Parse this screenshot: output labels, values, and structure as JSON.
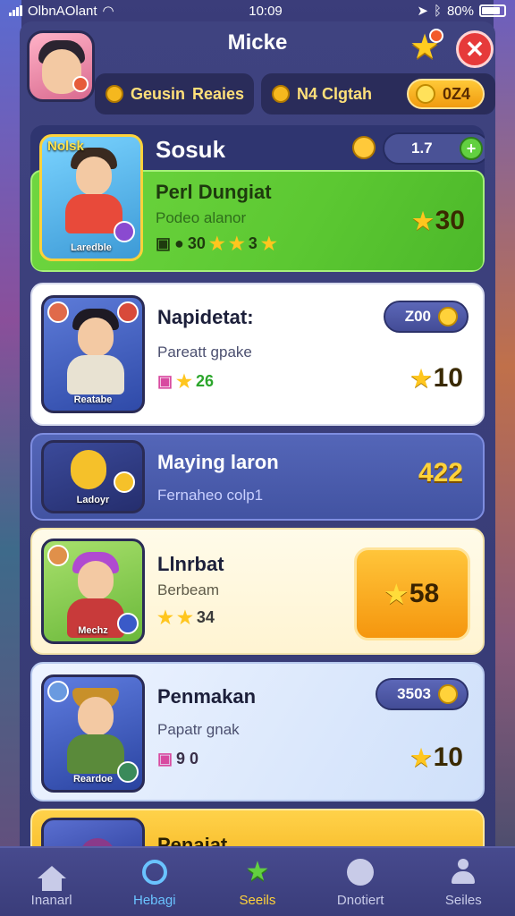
{
  "status_bar": {
    "carrier": "OlbnAOlant",
    "time": "10:09",
    "battery": "80%"
  },
  "header": {
    "title": "Micke",
    "left_label_1": "Geusin",
    "left_label_2": "Reaies",
    "right_label": "N4 Clgtah",
    "coins": "0Z4"
  },
  "section": {
    "title": "Sosuk",
    "counter": "1.7"
  },
  "cards": [
    {
      "thumb_badge": "Nolsk",
      "thumb_label": "Laredble",
      "name": "Perl Dungiat",
      "sub": "Podeo alanor",
      "rating_value": "30",
      "rating_extra": "3",
      "reward": "30"
    },
    {
      "thumb_label": "Reatabe",
      "name": "Napidetat:",
      "sub": "Pareatt gpake",
      "rating_value": "26",
      "pill": "Z00",
      "reward": "10"
    },
    {
      "thumb_label": "Ladoyr",
      "name": "Maying laron",
      "sub": "Fernaheo colp1",
      "reward": "422"
    },
    {
      "thumb_label": "Mechz",
      "name": "Llnrbat",
      "sub": "Berbeam",
      "rating_value": "34",
      "reward": "58"
    },
    {
      "thumb_label": "Reardoe",
      "name": "Penmakan",
      "sub": "Papatr gnak",
      "rating_value": "9 0",
      "pill": "3503",
      "reward": "10"
    },
    {
      "name": "Penaiat"
    }
  ],
  "nav": [
    {
      "label": "Inanarl",
      "icon": "home-icon"
    },
    {
      "label": "Hebagi",
      "icon": "search-icon"
    },
    {
      "label": "Seeils",
      "icon": "star-icon"
    },
    {
      "label": "Dnotiert",
      "icon": "face-icon"
    },
    {
      "label": "Seiles",
      "icon": "user-icon"
    }
  ],
  "colors": {
    "accent": "#ffd23a",
    "green": "#62d040",
    "close": "#e63a3a",
    "panel": "#3f4380"
  }
}
